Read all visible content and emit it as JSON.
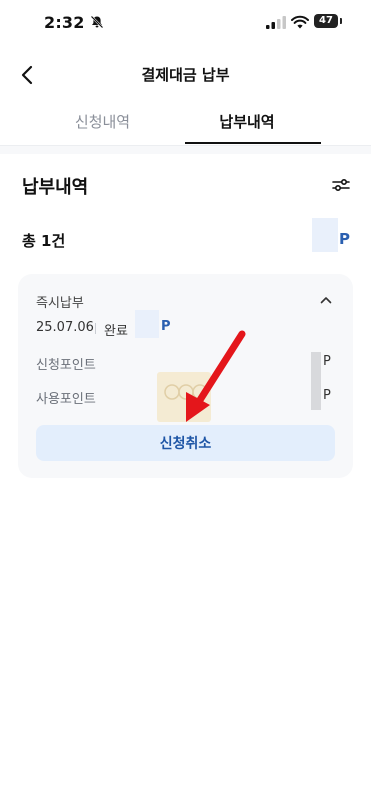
{
  "status_bar": {
    "time": "2:32",
    "battery": "47"
  },
  "header": {
    "title": "결제대금 납부"
  },
  "tabs": [
    {
      "label": "신청내역",
      "active": false
    },
    {
      "label": "납부내역",
      "active": true
    }
  ],
  "section": {
    "title": "납부내역",
    "total_label": "총 1건",
    "total_unit": "P"
  },
  "card": {
    "type": "즉시납부",
    "date": "25.07.06",
    "status": "완료",
    "amount_unit": "P",
    "rows": [
      {
        "label": "신청포인트",
        "unit": "P"
      },
      {
        "label": "사용포인트",
        "unit": "P"
      }
    ],
    "cancel_label": "신청취소"
  },
  "colors": {
    "accent": "#2a5fb0",
    "button_bg": "#e3eefc",
    "annotation_arrow": "#e4161b"
  }
}
